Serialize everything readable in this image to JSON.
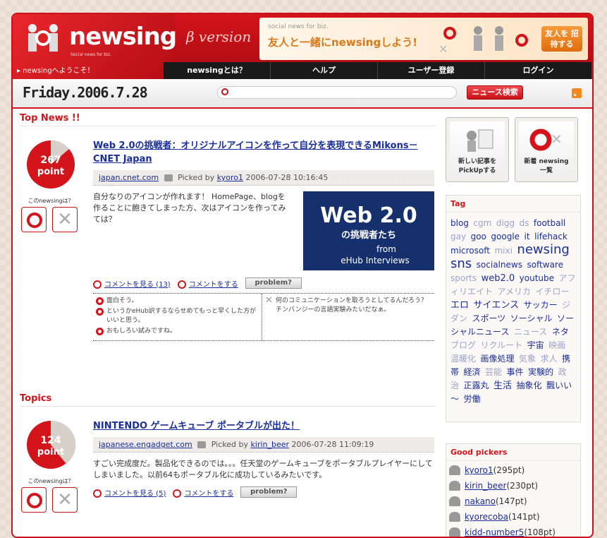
{
  "header": {
    "logo": "newsing",
    "logo_sub": "Social news for biz.",
    "beta": "β version",
    "welcome": "▸ newsingへようこそ！",
    "banner_small": "social news for biz.",
    "banner_big": "友人と一緒にnewsingしよう!",
    "banner_btn": "友人を 招待する"
  },
  "nav": [
    "newsingとは？",
    "ヘルプ",
    "ユーザー登録",
    "ログイン"
  ],
  "datebar": {
    "day": "Friday",
    "date": ".2006.7.28",
    "search_placeholder": "",
    "search_btn": "ニュース検索"
  },
  "top_news": {
    "heading": "Top News !!",
    "article": {
      "points": "267",
      "points_label": "point",
      "vote_label": "このnewsingは？",
      "title": "Web 2.0の挑戦者：オリジナルアイコンを作って自分を表現できるMikons－CNET Japan",
      "domain": "japan.cnet.com",
      "picked_by": "Picked by",
      "picker": "kyoro1",
      "datetime": "2006-07-28 10:16:45",
      "summary": "自分なりのアイコンが作れます！ HomePage、blogを作ることに飽きてしまった方、次はアイコンを作ってみては？",
      "thumb_title": "Web 2.0",
      "thumb_sub": "の挑戦者たち",
      "thumb_from": "from",
      "thumb_source": "eHub Interviews",
      "comments_link": "コメントを見る (13)",
      "comment_link": "コメントをする",
      "problem_btn": "problem?",
      "good_comments": [
        "面白そう。",
        "というかeHub訳するならせめてもっと早くした方がいいと思う。",
        "おもしろい試みですね。"
      ],
      "bad_comments": [
        "何のコミュニケーションを取ろうとしてるんだろう？チンパンジーの言語実験みたいだなぁ。"
      ]
    }
  },
  "topics": {
    "heading": "Topics",
    "article": {
      "points": "124",
      "points_label": "point",
      "vote_label": "このnewsingは？",
      "title": "NINTENDO ゲームキューブ ポータブルが出た！",
      "domain": "japanese.engadget.com",
      "picked_by": "Picked by",
      "picker": "kirin_beer",
      "datetime": "2006-07-28 11:09:19",
      "summary": "すごい完成度だ。製品化できるのでは。。。任天堂のゲームキューブをポータブルプレイヤーにしてしまいました。以前64もポータブル化に成功しているみたいです。",
      "comments_link": "コメントを見る (5)",
      "comment_link": "コメントをする",
      "problem_btn": "problem?"
    }
  },
  "sidebar": {
    "pickup_label": "新しい記事を PickUpする",
    "newslist_label": "新着 newsing一覧",
    "tag_heading": "Tag",
    "tags": [
      {
        "t": "blog",
        "c": "t1"
      },
      {
        "t": "cgm",
        "c": "t2"
      },
      {
        "t": "digg",
        "c": "t2"
      },
      {
        "t": "ds",
        "c": "t2"
      },
      {
        "t": "football",
        "c": "t1"
      },
      {
        "t": "gay",
        "c": "t2"
      },
      {
        "t": "goo",
        "c": "t1"
      },
      {
        "t": "google",
        "c": "t1"
      },
      {
        "t": "it",
        "c": "t1"
      },
      {
        "t": "lifehack",
        "c": "t1"
      },
      {
        "t": "microsoft",
        "c": "t1"
      },
      {
        "t": "mixi",
        "c": "t2"
      },
      {
        "t": "newsing",
        "c": "t4"
      },
      {
        "t": "sns",
        "c": "t4"
      },
      {
        "t": "socialnews",
        "c": "t1"
      },
      {
        "t": "software",
        "c": "t1"
      },
      {
        "t": "sports",
        "c": "t2"
      },
      {
        "t": "web2.0",
        "c": "t3"
      },
      {
        "t": "youtube",
        "c": "t1"
      },
      {
        "t": "アフィリエイト",
        "c": "t2"
      },
      {
        "t": "アメリカ",
        "c": "t2"
      },
      {
        "t": "イチロー",
        "c": "t2"
      },
      {
        "t": "エロ",
        "c": "t3"
      },
      {
        "t": "サイエンス",
        "c": "t3"
      },
      {
        "t": "サッカー",
        "c": "t1"
      },
      {
        "t": "ジダン",
        "c": "t2"
      },
      {
        "t": "スポーツ",
        "c": "t1"
      },
      {
        "t": "ソーシャル",
        "c": "t1"
      },
      {
        "t": "ソーシャルニュース",
        "c": "t1"
      },
      {
        "t": "ニュース",
        "c": "t2"
      },
      {
        "t": "ネタ",
        "c": "t1"
      },
      {
        "t": "ブログ",
        "c": "t2"
      },
      {
        "t": "リクルート",
        "c": "t2"
      },
      {
        "t": "宇宙",
        "c": "t1"
      },
      {
        "t": "映画",
        "c": "t2"
      },
      {
        "t": "温暖化",
        "c": "t2"
      },
      {
        "t": "画像処理",
        "c": "t1"
      },
      {
        "t": "気象",
        "c": "t2"
      },
      {
        "t": "求人",
        "c": "t2"
      },
      {
        "t": "携帯",
        "c": "t1"
      },
      {
        "t": "経済",
        "c": "t1"
      },
      {
        "t": "芸能",
        "c": "t2"
      },
      {
        "t": "事件",
        "c": "t1"
      },
      {
        "t": "実験的",
        "c": "t1"
      },
      {
        "t": "政治",
        "c": "t2"
      },
      {
        "t": "正露丸",
        "c": "t1"
      },
      {
        "t": "生活",
        "c": "t3"
      },
      {
        "t": "抽象化",
        "c": "t1"
      },
      {
        "t": "飄いい～",
        "c": "t1"
      },
      {
        "t": "労働",
        "c": "t1"
      }
    ],
    "pickers_heading": "Good pickers",
    "pickers": [
      {
        "name": "kyoro1",
        "pt": "(295pt)"
      },
      {
        "name": "kirin_beer",
        "pt": "(230pt)"
      },
      {
        "name": "nakano",
        "pt": "(147pt)"
      },
      {
        "name": "kyorecoba",
        "pt": "(141pt)"
      },
      {
        "name": "kidd-number5",
        "pt": "(108pt)"
      }
    ]
  }
}
